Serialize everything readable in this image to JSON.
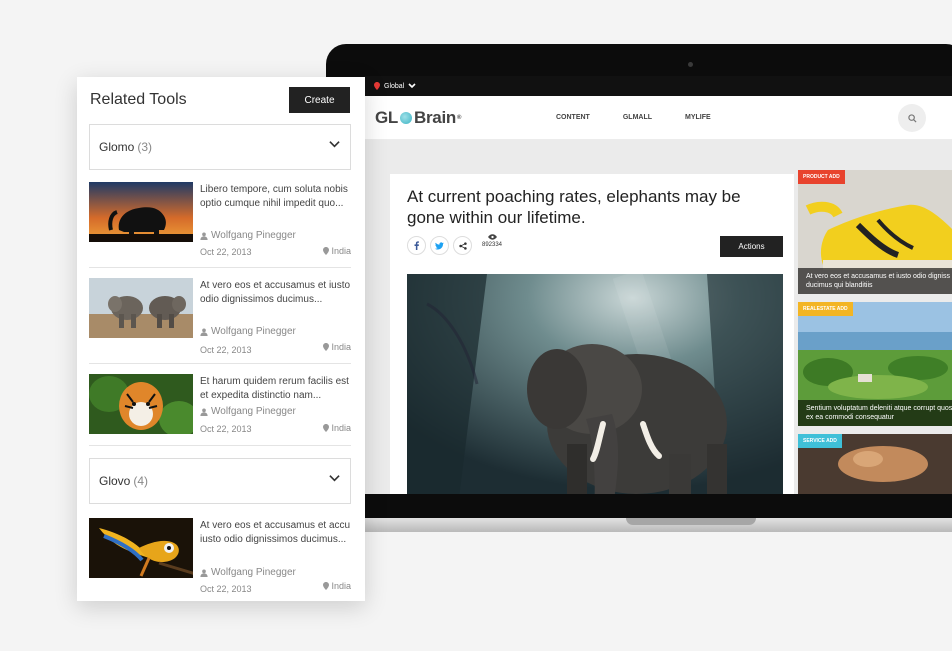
{
  "laptop": {
    "topbar": {
      "location": "Global"
    },
    "nav": {
      "logo_left": "GL",
      "logo_right": "Brain",
      "logo_mark": "®",
      "links": [
        "CONTENT",
        "GLMALL",
        "MYLIFE"
      ]
    },
    "article": {
      "title": "At current poaching rates, elephants may be gone within our lifetime.",
      "views": "892334",
      "actions_label": "Actions",
      "share_icons": [
        "facebook-icon",
        "twitter-icon",
        "share-icon"
      ]
    },
    "ads": [
      {
        "tag": "PRODUCT ADD",
        "tag_color": "#e8432d",
        "caption": "At vero eos et accusamus et iusto odio digniss ducimus qui blanditiis"
      },
      {
        "tag": "REALESTATE ADD",
        "tag_color": "#f3b524",
        "caption": "Sentium voluptatum deleniti atque corrupt quos ex ea commodi consequatur"
      },
      {
        "tag": "SERVICE ADD",
        "tag_color": "#3fc0d8",
        "caption": ""
      }
    ]
  },
  "panel": {
    "title": "Related Tools",
    "create_label": "Create",
    "groups": [
      {
        "name": "Glomo",
        "count": "(3)"
      },
      {
        "name": "Glovo",
        "count": "(4)"
      }
    ],
    "items": [
      {
        "text": "Libero tempore, cum soluta nobis optio cumque nihil impedit quo...",
        "author": "Wolfgang Pinegger",
        "date": "Oct 22, 2013",
        "location": "India"
      },
      {
        "text": "At vero eos et accusamus et iusto odio dignissimos ducimus...",
        "author": "Wolfgang Pinegger",
        "date": "Oct 22, 2013",
        "location": "India"
      },
      {
        "text": "Et harum quidem rerum facilis est et expedita distinctio nam...",
        "author": "Wolfgang Pinegger",
        "date": "Oct 22, 2013",
        "location": "India"
      },
      {
        "text": "At vero eos et accusamus et accu iusto odio dignissimos ducimus...",
        "author": "Wolfgang Pinegger",
        "date": "Oct 22, 2013",
        "location": "India"
      }
    ]
  }
}
